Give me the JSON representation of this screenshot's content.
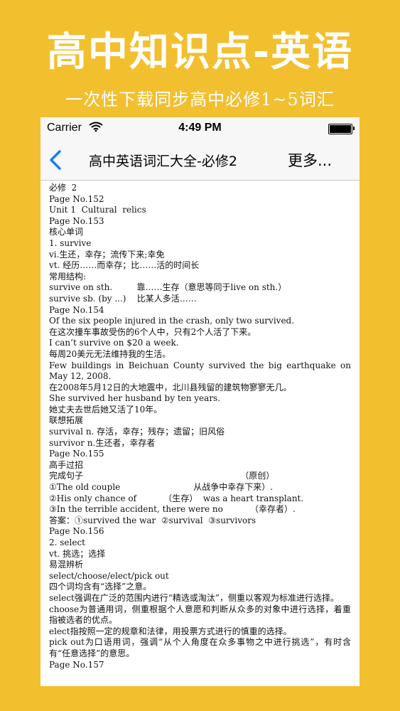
{
  "promo": {
    "title": "高中知识点-英语",
    "subtitle": "一次性下载同步高中必修1~5词汇"
  },
  "status_bar": {
    "carrier": "Carrier",
    "time": "4:49 PM"
  },
  "nav": {
    "title": "高中英语词汇大全-必修2",
    "more": "更多..."
  },
  "content": {
    "lines": [
      "必修  2",
      "Page No.152",
      "Unit 1  Cultural  relics",
      "Page No.153",
      "核心单词",
      "1. survive",
      "vi.生还，幸存；流传下来;幸免",
      "vt. 经历……而幸存；比……活的时间长",
      "常用结构:",
      "survive on sth.         靠……生存（意思等同于live on sth.）",
      "survive sb. (by ...)    比某人多活……",
      "Page No.154",
      "Of the six people injured in the crash, only two survived.",
      "在这次撞车事故受伤的6个人中，只有2个人活了下来。",
      "I can’t survive on $20 a week.",
      "每周20美元无法维持我的生活。",
      "Few buildings in Beichuan County survived the big earthquake on May 12, 2008.",
      "在2008年5月12日的大地震中，北川县残留的建筑物寥寥无几。",
      "She survived her husband by ten years.",
      "她丈夫去世后她又活了10年。",
      "联想拓展",
      "survival n. 存活，幸存；残存；遗留；旧风俗",
      "survivor n.生还者，幸存者",
      "Page No.155",
      "高手过招",
      "完成句子                                                          （原创）",
      "①The old couple                           从战争中幸存下来）.",
      "②His only chance of          （生存）  was a heart transplant.",
      "③In the terrible accident, there were no          （幸存者）.",
      "答案：①survived the war  ②survival  ③survivors",
      "Page No.156",
      "2. select",
      "vt. 挑选；选择",
      "易混辨析",
      "select/choose/elect/pick out",
      "四个词均含有“选择”之意。",
      "select强调在广泛的范围内进行“精选或淘汰”，侧重以客观为标准进行选择。",
      "choose为普通用词，侧重根据个人意愿和判断从众多的对象中进行选择，着重指被选者的优点。",
      "elect指按照一定的规章和法律，用投票方式进行的慎重的选择。",
      "pick out为口语用词，强调“从个人角度在众多事物之中进行挑选”，有时含有“任意选择”的意思。",
      "Page No.157"
    ]
  }
}
